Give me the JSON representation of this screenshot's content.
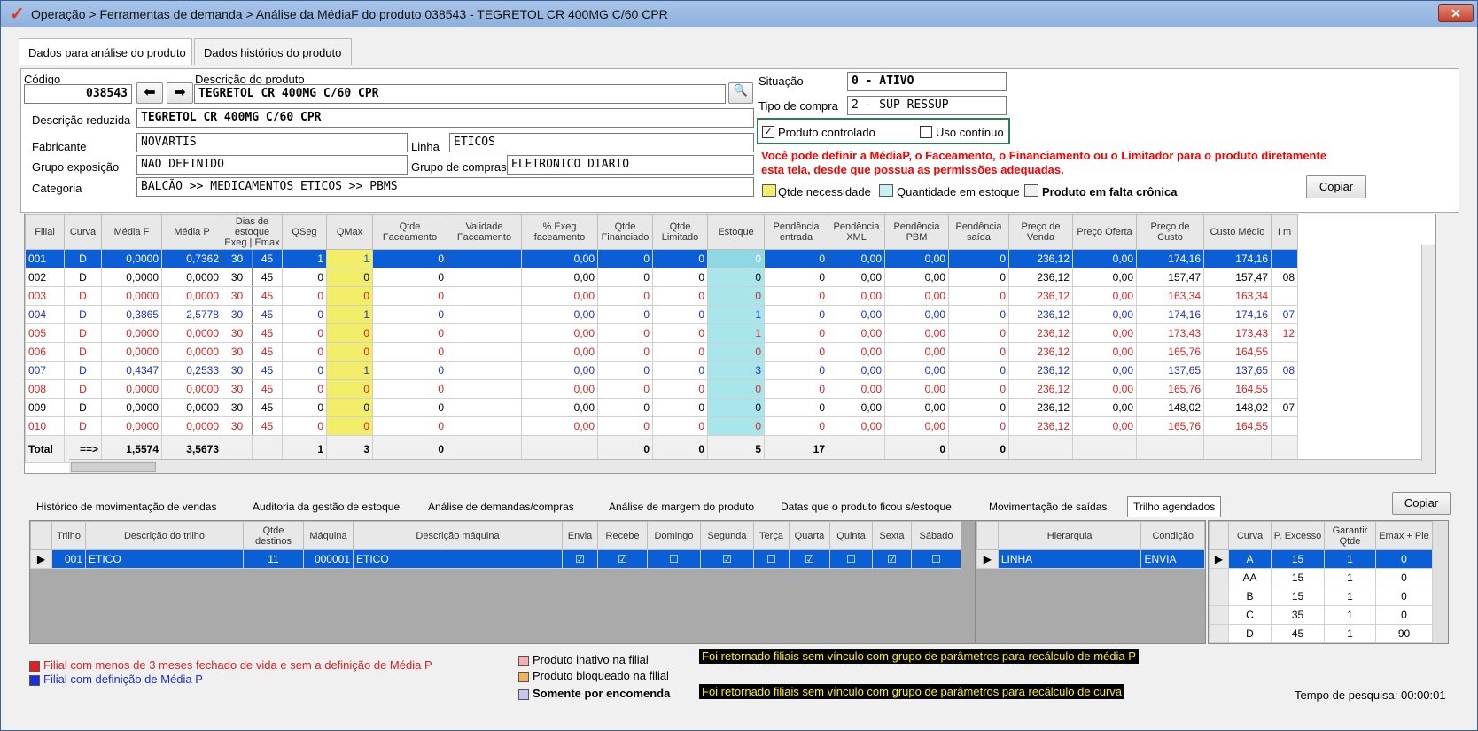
{
  "window": {
    "title": "Operação > Ferramentas de demanda > Análise da MédiaF do produto 038543 - TEGRETOL CR 400MG C/60 CPR"
  },
  "tabs": [
    {
      "label": "Dados para análise do produto"
    },
    {
      "label": "Dados histórios do produto"
    }
  ],
  "form": {
    "codigo_label": "Código",
    "codigo_value": "038543",
    "descricao_label": "Descrição do produto",
    "descricao_value": "TEGRETOL CR 400MG C/60 CPR",
    "desc_reduzida_label": "Descrição reduzida",
    "desc_reduzida_value": "TEGRETOL CR 400MG C/60 CPR",
    "fabricante_label": "Fabricante",
    "fabricante_value": "NOVARTIS",
    "linha_label": "Linha",
    "linha_value": "ETICOS",
    "grupo_exposicao_label": "Grupo exposição",
    "grupo_exposicao_value": "NAO DEFINIDO",
    "grupo_compras_label": "Grupo de compras",
    "grupo_compras_value": "ELETRONICO DIARIO",
    "categoria_label": "Categoria",
    "categoria_value": "BALCÃO >> MEDICAMENTOS ETICOS >> PBMS",
    "situacao_label": "Situação",
    "situacao_value": "0 - ATIVO",
    "tipo_compra_label": "Tipo de compra",
    "tipo_compra_value": "2 - SUP-RESSUP",
    "produto_controlado_label": "Produto controlado",
    "produto_controlado_checked": true,
    "uso_continuo_label": "Uso contínuo",
    "uso_continuo_checked": false,
    "warning_line1": "Você pode definir a MédiaP, o Faceamento, o Financiamento ou o Limitador para o produto diretamente",
    "warning_line2": "esta tela, desde que possua as permissões adequadas.",
    "legend_qtde": "Qtde necessidade",
    "legend_estoque": "Quantidade em estoque",
    "legend_falta": "Produto em falta crônica",
    "copiar_label": "Copiar"
  },
  "main_grid": {
    "headers": [
      "Filial",
      "Curva",
      "Média F",
      "Média P",
      "Dias de estoque Exeg | Emax",
      "QSeg",
      "QMax",
      "Qtde Faceamento",
      "Validade Faceamento",
      "% Exeg faceamento",
      "Qtde Financiado",
      "Qtde Limitado",
      "Estoque",
      "Pendência entrada",
      "Pendência XML",
      "Pendência PBM",
      "Pendência saída",
      "Preço de Venda",
      "Preço Oferta",
      "Preço de Custo",
      "Custo Médio",
      "I m"
    ],
    "rows": [
      {
        "filial": "001",
        "curva": "D",
        "mf": "0,0000",
        "mp": "0,7362",
        "d1": "30",
        "d2": "45",
        "qseg": "1",
        "qmax": "1",
        "qface": "0",
        "val": "",
        "pexeg": "0,00",
        "qfin": "0",
        "qlim": "0",
        "est": "0",
        "pent": "0",
        "pxml": "0,00",
        "ppbm": "0,00",
        "psai": "0",
        "pv": "236,12",
        "po": "0,00",
        "pc": "174,16",
        "cm": "174,16",
        "im": "",
        "style": "sel"
      },
      {
        "filial": "002",
        "curva": "D",
        "mf": "0,0000",
        "mp": "0,0000",
        "d1": "30",
        "d2": "45",
        "qseg": "0",
        "qmax": "0",
        "qface": "0",
        "val": "",
        "pexeg": "0,00",
        "qfin": "0",
        "qlim": "0",
        "est": "0",
        "pent": "0",
        "pxml": "0,00",
        "ppbm": "0,00",
        "psai": "0",
        "pv": "236,12",
        "po": "0,00",
        "pc": "157,47",
        "cm": "157,47",
        "im": "08",
        "style": "black"
      },
      {
        "filial": "003",
        "curva": "D",
        "mf": "0,0000",
        "mp": "0,0000",
        "d1": "30",
        "d2": "45",
        "qseg": "0",
        "qmax": "0",
        "qface": "0",
        "val": "",
        "pexeg": "0,00",
        "qfin": "0",
        "qlim": "0",
        "est": "0",
        "pent": "0",
        "pxml": "0,00",
        "ppbm": "0,00",
        "psai": "0",
        "pv": "236,12",
        "po": "0,00",
        "pc": "163,34",
        "cm": "163,34",
        "im": "",
        "style": "red"
      },
      {
        "filial": "004",
        "curva": "D",
        "mf": "0,3865",
        "mp": "2,5778",
        "d1": "30",
        "d2": "45",
        "qseg": "0",
        "qmax": "1",
        "qface": "0",
        "val": "",
        "pexeg": "0,00",
        "qfin": "0",
        "qlim": "0",
        "est": "1",
        "pent": "0",
        "pxml": "0,00",
        "ppbm": "0,00",
        "psai": "0",
        "pv": "236,12",
        "po": "0,00",
        "pc": "174,16",
        "cm": "174,16",
        "im": "07",
        "style": "blue"
      },
      {
        "filial": "005",
        "curva": "D",
        "mf": "0,0000",
        "mp": "0,0000",
        "d1": "30",
        "d2": "45",
        "qseg": "0",
        "qmax": "0",
        "qface": "0",
        "val": "",
        "pexeg": "0,00",
        "qfin": "0",
        "qlim": "0",
        "est": "1",
        "pent": "0",
        "pxml": "0,00",
        "ppbm": "0,00",
        "psai": "0",
        "pv": "236,12",
        "po": "0,00",
        "pc": "173,43",
        "cm": "173,43",
        "im": "12",
        "style": "red"
      },
      {
        "filial": "006",
        "curva": "D",
        "mf": "0,0000",
        "mp": "0,0000",
        "d1": "30",
        "d2": "45",
        "qseg": "0",
        "qmax": "0",
        "qface": "0",
        "val": "",
        "pexeg": "0,00",
        "qfin": "0",
        "qlim": "0",
        "est": "0",
        "pent": "0",
        "pxml": "0,00",
        "ppbm": "0,00",
        "psai": "0",
        "pv": "236,12",
        "po": "0,00",
        "pc": "165,76",
        "cm": "164,55",
        "im": "",
        "style": "red"
      },
      {
        "filial": "007",
        "curva": "D",
        "mf": "0,4347",
        "mp": "0,2533",
        "d1": "30",
        "d2": "45",
        "qseg": "0",
        "qmax": "1",
        "qface": "0",
        "val": "",
        "pexeg": "0,00",
        "qfin": "0",
        "qlim": "0",
        "est": "3",
        "pent": "0",
        "pxml": "0,00",
        "ppbm": "0,00",
        "psai": "0",
        "pv": "236,12",
        "po": "0,00",
        "pc": "137,65",
        "cm": "137,65",
        "im": "08",
        "style": "blue"
      },
      {
        "filial": "008",
        "curva": "D",
        "mf": "0,0000",
        "mp": "0,0000",
        "d1": "30",
        "d2": "45",
        "qseg": "0",
        "qmax": "0",
        "qface": "0",
        "val": "",
        "pexeg": "0,00",
        "qfin": "0",
        "qlim": "0",
        "est": "0",
        "pent": "0",
        "pxml": "0,00",
        "ppbm": "0,00",
        "psai": "0",
        "pv": "236,12",
        "po": "0,00",
        "pc": "165,76",
        "cm": "164,55",
        "im": "",
        "style": "red"
      },
      {
        "filial": "009",
        "curva": "D",
        "mf": "0,0000",
        "mp": "0,0000",
        "d1": "30",
        "d2": "45",
        "qseg": "0",
        "qmax": "0",
        "qface": "0",
        "val": "",
        "pexeg": "0,00",
        "qfin": "0",
        "qlim": "0",
        "est": "0",
        "pent": "0",
        "pxml": "0,00",
        "ppbm": "0,00",
        "psai": "0",
        "pv": "236,12",
        "po": "0,00",
        "pc": "148,02",
        "cm": "148,02",
        "im": "07",
        "style": "black"
      },
      {
        "filial": "010",
        "curva": "D",
        "mf": "0,0000",
        "mp": "0,0000",
        "d1": "30",
        "d2": "45",
        "qseg": "0",
        "qmax": "0",
        "qface": "0",
        "val": "",
        "pexeg": "0,00",
        "qfin": "0",
        "qlim": "0",
        "est": "0",
        "pent": "0",
        "pxml": "0,00",
        "ppbm": "0,00",
        "psai": "0",
        "pv": "236,12",
        "po": "0,00",
        "pc": "165,76",
        "cm": "164,55",
        "im": "",
        "style": "red"
      }
    ],
    "total": {
      "label": "Total",
      "arrow": "==>",
      "mf": "1,5574",
      "mp": "3,5673",
      "qseg": "1",
      "qmax": "3",
      "qface": "0",
      "qfin": "0",
      "qlim": "0",
      "est": "5",
      "pent": "17",
      "ppbm": "0",
      "psai": "0"
    }
  },
  "bottom_tabs": [
    "Histórico de movimentação de vendas",
    "Auditoria da gestão de estoque",
    "Análise de demandas/compras",
    "Análise de margem do produto",
    "Datas que o produto ficou s/estoque",
    "Movimentação de saídas",
    "Trilho agendados"
  ],
  "bottom_copiar": "Copiar",
  "trilho_grid": {
    "headers": [
      "Trilho",
      "Descrição do trilho",
      "Qtde destinos",
      "Máquina",
      "Descrição máquina",
      "Envia",
      "Recebe",
      "Domingo",
      "Segunda",
      "Terça",
      "Quarta",
      "Quinta",
      "Sexta",
      "Sábado"
    ],
    "row": {
      "trilho": "001",
      "desc": "ETICO",
      "qtde": "11",
      "maquina": "000001",
      "descmaq": "ETICO"
    }
  },
  "hier_grid": {
    "headers": [
      "Hierarquia",
      "Condição"
    ],
    "row": {
      "hier": "LINHA",
      "cond": "ENVIA"
    }
  },
  "curva_grid": {
    "headers": [
      "Curva",
      "P. Excesso",
      "Garantir Qtde",
      "Emax + Pie"
    ],
    "rows": [
      {
        "c": "A",
        "p": "15",
        "g": "1",
        "e": "0"
      },
      {
        "c": "AA",
        "p": "15",
        "g": "1",
        "e": "0"
      },
      {
        "c": "B",
        "p": "15",
        "g": "1",
        "e": "0"
      },
      {
        "c": "C",
        "p": "35",
        "g": "1",
        "e": "0"
      },
      {
        "c": "D",
        "p": "45",
        "g": "1",
        "e": "90"
      }
    ]
  },
  "footer": {
    "legend_red": "Filial com menos de 3 meses fechado de vida e sem a definição de Média P",
    "legend_blue": "Filial com definição de Média P",
    "inativo": "Produto inativo na filial",
    "bloqueado": "Produto bloqueado na filial",
    "encomenda": "Somente por encomenda",
    "msg1": "Foi retornado filiais sem vínculo com grupo de parâmetros para recálculo de média P",
    "msg2": "Foi retornado filiais sem vínculo com grupo de parâmetros para recálculo de curva",
    "tempo": "Tempo de pesquisa: 00:00:01"
  },
  "colors": {
    "selected": "#0a5fd6",
    "red": "#e02020",
    "blue": "#1a2fd6",
    "yellow": "#f2ee6a",
    "cyan": "#a9e6ec",
    "warning": "#ff0000"
  }
}
